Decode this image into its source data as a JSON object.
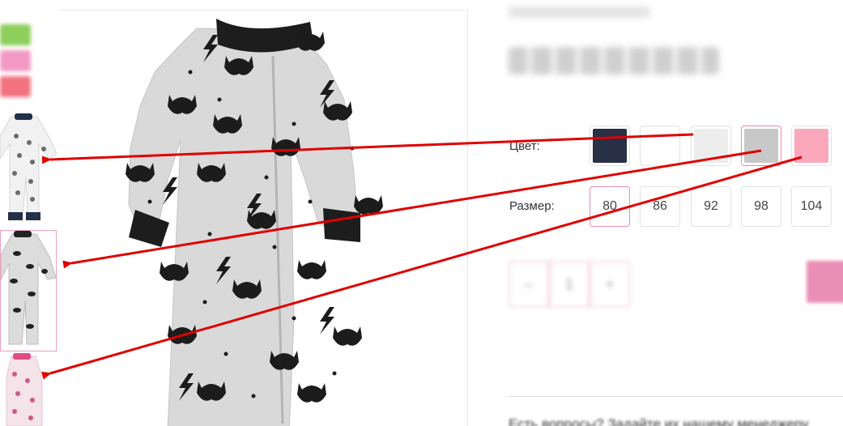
{
  "product": {
    "color_label": "Цвет:",
    "size_label": "Размер:",
    "colors": [
      {
        "name": "navy",
        "hex": "#283046"
      },
      {
        "name": "white",
        "hex": "#ffffff"
      },
      {
        "name": "light-gray",
        "hex": "#ededed"
      },
      {
        "name": "gray",
        "hex": "#c8c8c8"
      },
      {
        "name": "pink",
        "hex": "#fba8bc"
      }
    ],
    "selected_color": "gray",
    "sizes": [
      "80",
      "86",
      "92",
      "98",
      "104"
    ],
    "selected_size": "80"
  },
  "sidebar": {
    "color_chips": [
      "#8ccf5a",
      "#f29ac4",
      "#f2737f"
    ],
    "thumbnails": [
      "onesie-white-print",
      "onesie-gray-mask-print",
      "onesie-pink-print"
    ],
    "active_thumbnail": 1
  },
  "annotations": {
    "arrow_color": "#e00000"
  },
  "colors": {
    "accent": "#e58cb5"
  }
}
